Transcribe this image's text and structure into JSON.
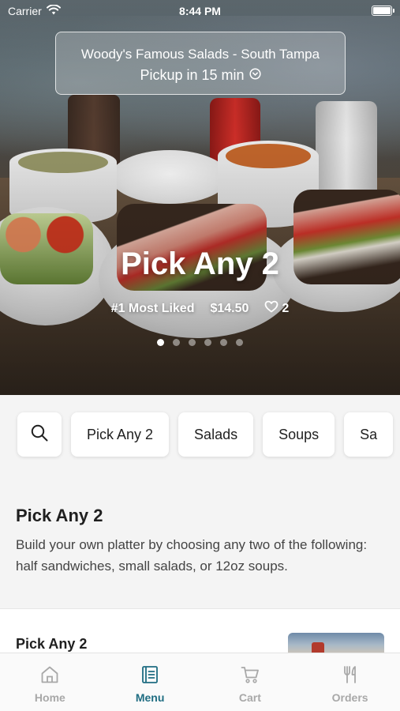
{
  "status_bar": {
    "carrier": "Carrier",
    "time": "8:44 PM"
  },
  "store": {
    "name": "Woody's Famous Salads - South Tampa",
    "pickup": "Pickup in 15 min"
  },
  "hero": {
    "title": "Pick Any 2",
    "badge": "#1 Most Liked",
    "price": "$14.50",
    "likes": "2",
    "carousel": {
      "total": 6,
      "active_index": 0
    }
  },
  "categories": [
    "Pick Any 2",
    "Salads",
    "Soups",
    "Sa"
  ],
  "section": {
    "title": "Pick Any 2",
    "description": "Build your own platter by choosing any two of the following: half sandwiches, small salads, or 12oz soups."
  },
  "item": {
    "name": "Pick Any 2"
  },
  "tabs": [
    {
      "label": "Home",
      "icon": "home-icon",
      "active": false
    },
    {
      "label": "Menu",
      "icon": "menu-book-icon",
      "active": true
    },
    {
      "label": "Cart",
      "icon": "cart-icon",
      "active": false
    },
    {
      "label": "Orders",
      "icon": "fork-knife-icon",
      "active": false
    }
  ],
  "colors": {
    "accent": "#1f6d82",
    "inactive_tab": "#a8a8a8",
    "background": "#f4f4f4"
  }
}
